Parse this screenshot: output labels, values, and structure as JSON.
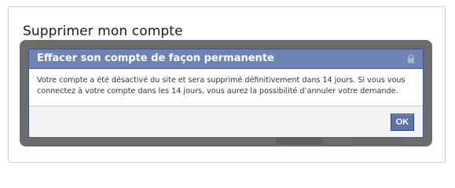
{
  "page": {
    "title": "Supprimer mon compte"
  },
  "dialog": {
    "title": "Effacer son compte de façon permanente",
    "header_icon": "lock-icon",
    "message": "Votre compte a été désactivé du site et sera supprimé définitivement dans 14 jours. Si vous vous connectez à votre compte dans les 14 jours, vous aurez la possibilité d’annuler votre demande.",
    "ok_label": "OK"
  },
  "colors": {
    "header_bg": "#6d84b4",
    "header_border": "#3b5998",
    "overlay": "#5f5f5f",
    "button_bg": "#5b74a8",
    "footer_bg": "#f2f2f2"
  }
}
